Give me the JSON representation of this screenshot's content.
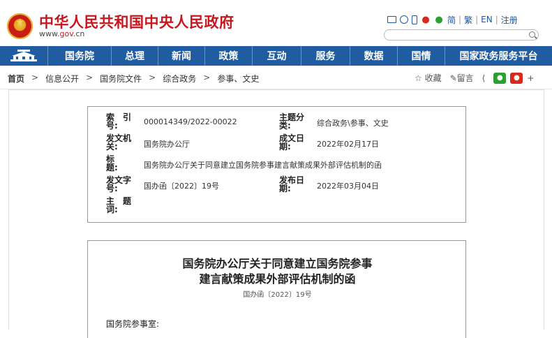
{
  "header": {
    "site_title": "中华人民共和国中央人民政府",
    "site_url_prefix": "www.",
    "site_url_domain": "gov",
    "site_url_suffix": ".cn",
    "toolbar": {
      "icons": [
        "mail-icon",
        "chat-icon",
        "phone-icon",
        "weibo-icon",
        "wechat-icon"
      ],
      "links": [
        "简",
        "繁",
        "EN",
        "注册"
      ]
    },
    "search": {
      "placeholder": ""
    }
  },
  "nav": {
    "items": [
      "国务院",
      "总理",
      "新闻",
      "政策",
      "互动",
      "服务",
      "数据",
      "国情",
      "国家政务服务平台"
    ]
  },
  "breadcrumb": {
    "items": [
      "首页",
      "信息公开",
      "国务院文件",
      "综合政务",
      "参事、文史"
    ],
    "separator": ">"
  },
  "actions": {
    "favorite": "☆ 收藏",
    "comment": "留言",
    "share_icon": "share-icon",
    "wechat_icon": "wechat-icon",
    "weibo_icon": "weibo-icon",
    "font_plus": "+"
  },
  "meta": {
    "index_label": "索　引　号:",
    "index_value": "000014349/2022-00022",
    "category_label": "主题分类:",
    "category_value": "综合政务\\参事、文史",
    "issuer_label": "发文机关:",
    "issuer_value": "国务院办公厅",
    "written_label": "成文日期:",
    "written_value": "2022年02月17日",
    "title_label": "标　　题:",
    "title_value": "国务院办公厅关于同意建立国务院参事建言献策成果外部评估机制的函",
    "docno_label": "发文字号:",
    "docno_value": "国办函〔2022〕19号",
    "publish_label": "发布日期:",
    "publish_value": "2022年03月04日",
    "keywords_label": "主　题　词:",
    "keywords_value": ""
  },
  "document": {
    "title_line1": "国务院办公厅关于同意建立国务院参事",
    "title_line2": "建言献策成果外部评估机制的函",
    "number": "国办函〔2022〕19号",
    "recipient": "国务院参事室:"
  },
  "colors": {
    "brand_red": "#c8161d",
    "nav_blue": "#1f5ca1",
    "link_blue": "#1a56a4"
  }
}
